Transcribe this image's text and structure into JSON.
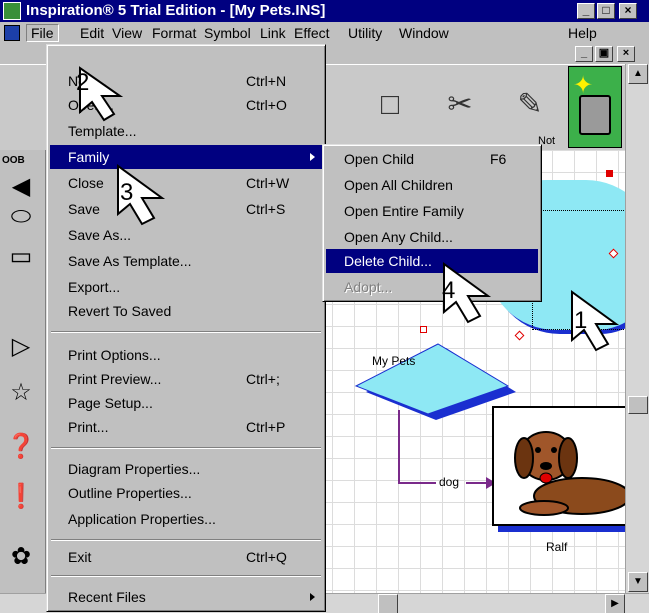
{
  "window": {
    "title": "Inspiration® 5 Trial Edition - [My Pets.INS]"
  },
  "window_buttons": {
    "minimize": "_",
    "maximize": "□",
    "close": "×"
  },
  "doc_buttons": {
    "minimize": "_",
    "restore": "▣",
    "close": "×"
  },
  "menu_bar": [
    {
      "label": "File"
    },
    {
      "label": "Edit"
    },
    {
      "label": "View"
    },
    {
      "label": "Format"
    },
    {
      "label": "Symbol"
    },
    {
      "label": "Link"
    },
    {
      "label": "Effect"
    },
    {
      "label": "Utility"
    },
    {
      "label": "Window"
    },
    {
      "label": "Help"
    }
  ],
  "toolbar": {
    "label_fragment": "Not"
  },
  "left_strip": {
    "label": "OOB"
  },
  "file_menu": [
    {
      "label": "New...",
      "shortcut": "Ctrl+N"
    },
    {
      "label": "Open...",
      "shortcut": "Ctrl+O"
    },
    {
      "label": "Template...",
      "shortcut": ""
    },
    {
      "label": "Family",
      "shortcut": ""
    },
    {
      "label": "Close",
      "shortcut": "Ctrl+W"
    },
    {
      "label": "Save",
      "shortcut": "Ctrl+S"
    },
    {
      "label": "Save As...",
      "shortcut": ""
    },
    {
      "label": "Save As Template...",
      "shortcut": ""
    },
    {
      "label": "Export...",
      "shortcut": ""
    },
    {
      "label": "Revert To Saved",
      "shortcut": ""
    },
    {
      "label": "Print Options...",
      "shortcut": ""
    },
    {
      "label": "Print Preview...",
      "shortcut": "Ctrl+;"
    },
    {
      "label": "Page Setup...",
      "shortcut": ""
    },
    {
      "label": "Print...",
      "shortcut": "Ctrl+P"
    },
    {
      "label": "Diagram Properties...",
      "shortcut": ""
    },
    {
      "label": "Outline Properties...",
      "shortcut": ""
    },
    {
      "label": "Application Properties...",
      "shortcut": ""
    },
    {
      "label": "Exit",
      "shortcut": "Ctrl+Q"
    },
    {
      "label": "Recent Files",
      "shortcut": ""
    }
  ],
  "family_submenu": [
    {
      "label": "Open Child",
      "shortcut": "F6"
    },
    {
      "label": "Open All Children",
      "shortcut": ""
    },
    {
      "label": "Open Entire Family",
      "shortcut": ""
    },
    {
      "label": "Open Any Child...",
      "shortcut": ""
    },
    {
      "label": "Delete Child...",
      "shortcut": ""
    },
    {
      "label": "Adopt...",
      "shortcut": ""
    }
  ],
  "diagram": {
    "main_label": "My Pets",
    "link_label": "dog",
    "picture_label": "Ralf"
  },
  "steps": [
    "1",
    "2",
    "3",
    "4"
  ],
  "colors": {
    "title_bar": "#000080",
    "highlight": "#000080",
    "cloud": "#8ee8f4",
    "shadow": "#1a2fd0",
    "link": "#7a2a8a"
  }
}
